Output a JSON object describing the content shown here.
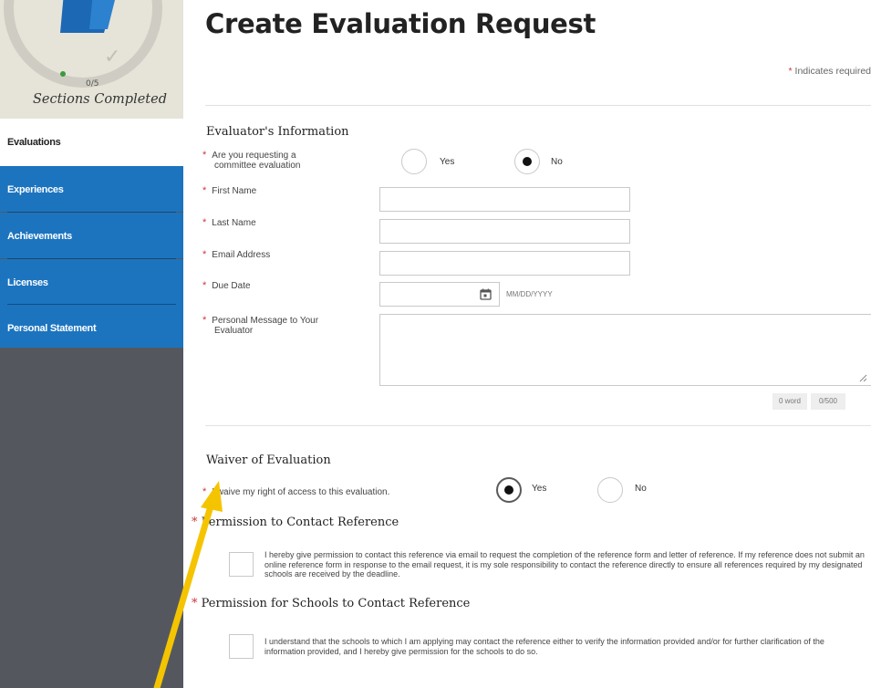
{
  "sidebar": {
    "progress_count": "0/5",
    "progress_label": "Sections Completed",
    "items": [
      {
        "label": "Evaluations",
        "active": true
      },
      {
        "label": "Experiences",
        "active": false
      },
      {
        "label": "Achievements",
        "active": false
      },
      {
        "label": "Licenses",
        "active": false
      },
      {
        "label": "Personal Statement",
        "active": false
      }
    ]
  },
  "page": {
    "title": "Create Evaluation Request",
    "required_note": "Indicates required",
    "required_star": "*"
  },
  "evaluator": {
    "section_title": "Evaluator's Information",
    "committee_question_line1": "Are you requesting a",
    "committee_question_line2": "committee evaluation",
    "committee_yes": "Yes",
    "committee_no": "No",
    "committee_value": "No",
    "first_name_label": "First Name",
    "first_name_value": "",
    "last_name_label": "Last Name",
    "last_name_value": "",
    "email_label": "Email Address",
    "email_value": "",
    "due_date_label": "Due Date",
    "due_date_value": "",
    "due_date_hint": "MM/DD/YYYY",
    "message_label_line1": "Personal Message to Your",
    "message_label_line2": "Evaluator",
    "message_value": "",
    "word_count": "0 word",
    "char_count": "0/500"
  },
  "waiver": {
    "section_title": "Waiver of Evaluation",
    "question": "I waive my right of access to this evaluation.",
    "yes": "Yes",
    "no": "No",
    "value": "Yes"
  },
  "permission_contact": {
    "title": "Permission to Contact Reference",
    "text": "I hereby give permission to contact this reference via email to request the completion of the reference form and letter of reference. If my reference does not submit an online reference form in response to the email request, it is my sole responsibility to contact the reference directly to ensure all references required by my designated schools are received by the deadline."
  },
  "permission_schools": {
    "title": "Permission for Schools to Contact Reference",
    "text": "I understand that the schools to which I am applying may contact the reference either to verify the information provided and/or for further clarification of the information provided, and I hereby give permission for the schools to do so."
  },
  "colors": {
    "nav_blue": "#1c74bf",
    "sidebar_gray": "#54585e",
    "required_red": "#c8383a",
    "annotation_arrow": "#f5c400"
  },
  "icons": [
    "folder-icon",
    "checkmark-icon",
    "calendar-icon",
    "resize-grip-icon",
    "annotation-arrow"
  ]
}
